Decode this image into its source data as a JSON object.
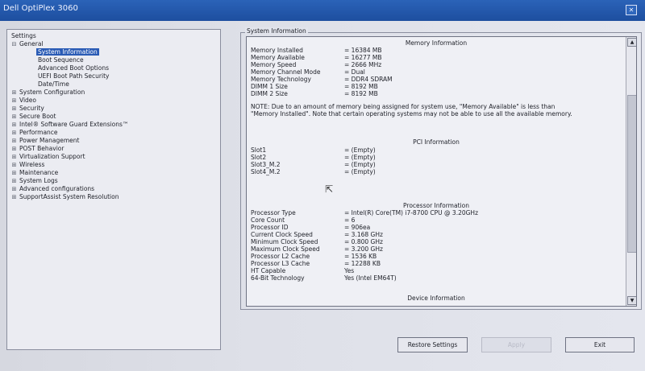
{
  "window": {
    "title": "Dell OptiPlex 3060"
  },
  "tree": {
    "root": "Settings",
    "general_label": "General",
    "general_children": [
      "System Information",
      "Boot Sequence",
      "Advanced Boot Options",
      "UEFI Boot Path Security",
      "Date/Time"
    ],
    "sections": [
      "System Configuration",
      "Video",
      "Security",
      "Secure Boot",
      "Intel® Software Guard Extensions™",
      "Performance",
      "Power Management",
      "POST Behavior",
      "Virtualization Support",
      "Wireless",
      "Maintenance",
      "System Logs",
      "Advanced configurations",
      "SupportAssist System Resolution"
    ]
  },
  "panel": {
    "group_label": "System Information",
    "memory_title": "Memory Information",
    "memory": [
      {
        "k": "Memory Installed",
        "v": "= 16384 MB"
      },
      {
        "k": "Memory Available",
        "v": "= 16277 MB"
      },
      {
        "k": "Memory Speed",
        "v": "= 2666 MHz"
      },
      {
        "k": "Memory Channel Mode",
        "v": "= Dual"
      },
      {
        "k": "Memory Technology",
        "v": "= DDR4 SDRAM"
      },
      {
        "k": "DIMM 1 Size",
        "v": "= 8192 MB"
      },
      {
        "k": "DIMM 2 Size",
        "v": "= 8192 MB"
      }
    ],
    "note": "NOTE: Due to an amount of memory being assigned for system use, \"Memory Available\" is less than \"Memory Installed\". Note that certain operating systems may not be able to use all the available memory.",
    "pci_title": "PCI Information",
    "pci": [
      {
        "k": "Slot1",
        "v": "= (Empty)"
      },
      {
        "k": "Slot2",
        "v": "= (Empty)"
      },
      {
        "k": "Slot3_M.2",
        "v": "= (Empty)"
      },
      {
        "k": "Slot4_M.2",
        "v": "= (Empty)"
      }
    ],
    "processor_title": "Processor Information",
    "processor": [
      {
        "k": "Processor Type",
        "v": "= Intel(R) Core(TM) i7-8700 CPU @ 3.20GHz"
      },
      {
        "k": "Core Count",
        "v": "= 6"
      },
      {
        "k": "Processor ID",
        "v": "= 906ea"
      },
      {
        "k": "Current Clock Speed",
        "v": "= 3.168 GHz"
      },
      {
        "k": "Minimum Clock Speed",
        "v": "= 0.800 GHz"
      },
      {
        "k": "Maximum Clock Speed",
        "v": "= 3.200 GHz"
      },
      {
        "k": "Processor L2 Cache",
        "v": "= 1536 KB"
      },
      {
        "k": "Processor L3 Cache",
        "v": "= 12288 KB"
      },
      {
        "k": "HT Capable",
        "v": "Yes"
      },
      {
        "k": "64-Bit Technology",
        "v": "Yes (Intel EM64T)"
      }
    ],
    "device_title": "Device Information"
  },
  "buttons": {
    "restore": "Restore Settings",
    "apply": "Apply",
    "exit": "Exit"
  },
  "icons": {
    "close": "close-icon",
    "expand": "plus-icon",
    "collapse": "minus-icon",
    "scroll_up": "arrow-up-icon",
    "scroll_down": "arrow-down-icon",
    "cursor": "mouse-cursor-icon"
  }
}
